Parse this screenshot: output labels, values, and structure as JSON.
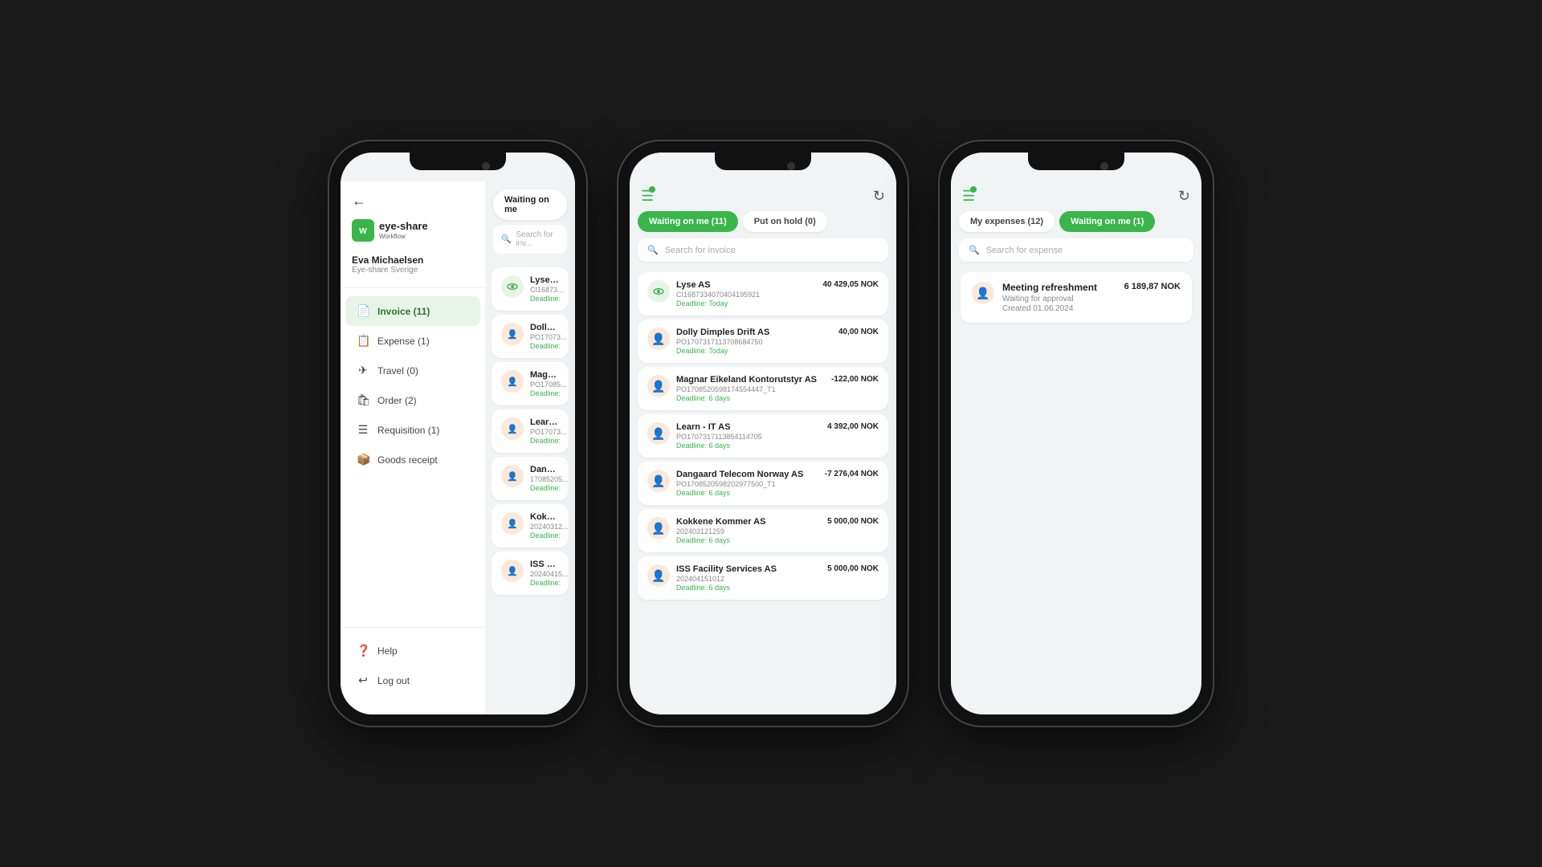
{
  "phone1": {
    "back_label": "←",
    "logo_icon": "W",
    "logo_text": "eye-share",
    "logo_sub": "Workflow",
    "user_name": "Eva Michaelsen",
    "user_company": "Eye-share Sverige",
    "nav_items": [
      {
        "id": "invoice",
        "icon": "📄",
        "label": "Invoice (11)",
        "active": true
      },
      {
        "id": "expense",
        "icon": "📋",
        "label": "Expense (1)",
        "active": false
      },
      {
        "id": "travel",
        "icon": "✈",
        "label": "Travel (0)",
        "active": false
      },
      {
        "id": "order",
        "icon": "🛍",
        "label": "Order (2)",
        "active": false
      },
      {
        "id": "requisition",
        "icon": "☰",
        "label": "Requisition (1)",
        "active": false
      },
      {
        "id": "goods-receipt",
        "icon": "📦",
        "label": "Goods receipt",
        "active": false
      }
    ],
    "bottom_nav": [
      {
        "id": "help",
        "icon": "❓",
        "label": "Help"
      },
      {
        "id": "logout",
        "icon": "↩",
        "label": "Log out"
      }
    ],
    "tab_label": "Waiting on me",
    "search_placeholder": "Search for inv...",
    "cards": [
      {
        "name": "Lyse AS",
        "ref": "CI16873...",
        "deadline": "Deadline:",
        "avatar_type": "eye"
      },
      {
        "name": "Dolly Di...",
        "ref": "PO17073...",
        "deadline": "Deadline:",
        "avatar_type": "person"
      },
      {
        "name": "Magnar...",
        "ref": "PO17085...",
        "deadline": "Deadline:",
        "avatar_type": "person"
      },
      {
        "name": "Learn - I...",
        "ref": "PO17073...",
        "deadline": "Deadline:",
        "avatar_type": "person"
      },
      {
        "name": "Dangaar...",
        "ref": "17085205...",
        "deadline": "Deadline:",
        "avatar_type": "person"
      },
      {
        "name": "Kokkene...",
        "ref": "20240312...",
        "deadline": "Deadline:",
        "avatar_type": "person"
      },
      {
        "name": "ISS Faci...",
        "ref": "20240415...",
        "deadline": "Deadline:",
        "avatar_type": "person"
      }
    ]
  },
  "phone2": {
    "tab_waiting_label": "Waiting on me (11)",
    "tab_hold_label": "Put on hold (0)",
    "search_placeholder": "Search for invoice",
    "cards": [
      {
        "name": "Lyse AS",
        "ref": "CI16873340704041959​21",
        "deadline": "Deadline: Today",
        "amount": "40 429,05 NOK",
        "avatar_type": "eye"
      },
      {
        "name": "Dolly Dimples Drift AS",
        "ref": "PO170731711370868​4750",
        "deadline": "Deadline: Today",
        "amount": "40,00 NOK",
        "avatar_type": "person"
      },
      {
        "name": "Magnar Eikeland Kontorutstyr AS",
        "ref": "PO17085205981745544​47_T1",
        "deadline": "Deadline: 6 days",
        "amount": "-122,00 NOK",
        "avatar_type": "person"
      },
      {
        "name": "Learn - IT AS",
        "ref": "PO17073171138541​14705",
        "deadline": "Deadline: 6 days",
        "amount": "4 392,00 NOK",
        "avatar_type": "person"
      },
      {
        "name": "Dangaard Telecom Norway AS",
        "ref": "PO170852059820297​7500_T1",
        "deadline": "Deadline: 6 days",
        "amount": "-7 276,04 NOK",
        "avatar_type": "person"
      },
      {
        "name": "Kokkene Kommer AS",
        "ref": "202403121259",
        "deadline": "Deadline: 6 days",
        "amount": "5 000,00 NOK",
        "avatar_type": "person"
      },
      {
        "name": "ISS Facility Services AS",
        "ref": "202404151012",
        "deadline": "Deadline: 6 days",
        "amount": "5 000,00 NOK",
        "avatar_type": "person"
      }
    ]
  },
  "phone3": {
    "tab_expenses_label": "My expenses (12)",
    "tab_waiting_label": "Waiting on me (1)",
    "search_placeholder": "Search for expense",
    "expense": {
      "name": "Meeting refreshment",
      "status": "Waiting for approval",
      "date": "Created 01.06.2024",
      "amount": "6 189,87 NOK"
    }
  },
  "icons": {
    "hamburger": "☰",
    "refresh": "↻",
    "search": "🔍",
    "back": "←",
    "eye": "👁",
    "person": "👤",
    "help": "❓",
    "logout": "⬛"
  }
}
